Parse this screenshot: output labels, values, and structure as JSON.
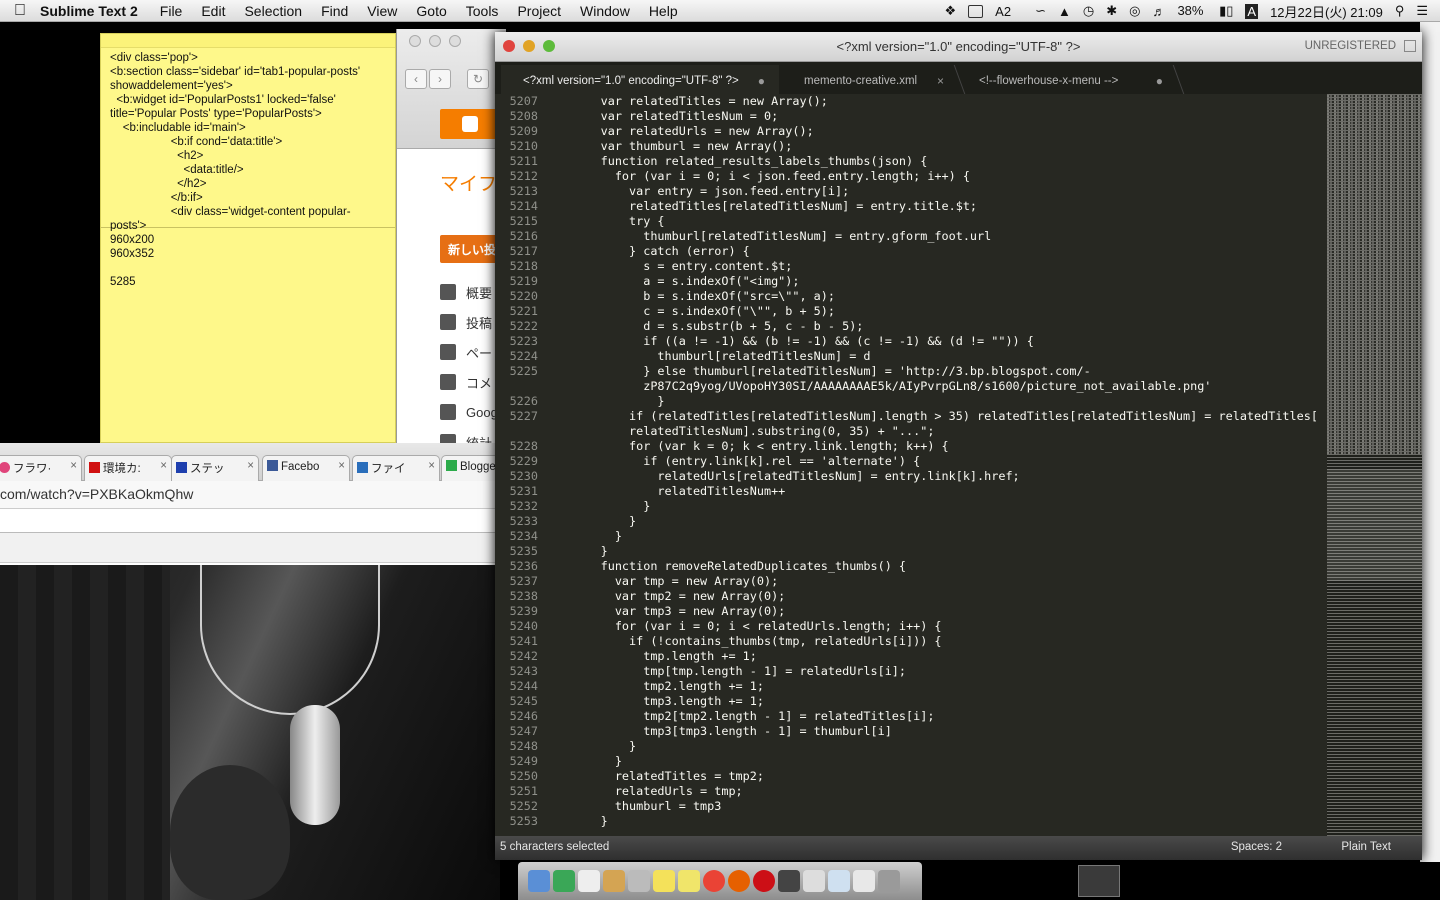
{
  "menubar": {
    "app_name": "Sublime Text 2",
    "menus": [
      "File",
      "Edit",
      "Selection",
      "Find",
      "View",
      "Goto",
      "Tools",
      "Project",
      "Window",
      "Help"
    ],
    "input_indicator": "2",
    "battery": "38%",
    "input_source": "A",
    "date_time": "12月22日(火)  21:09"
  },
  "sticky": {
    "code": "<div class='pop'>\n<b:section class='sidebar' id='tab1-popular-posts' showaddelement='yes'>\n  <b:widget id='PopularPosts1' locked='false' title='Popular Posts' type='PopularPosts'>\n    <b:includable id='main'>\n                   <b:if cond='data:title'>\n                     <h2>\n                       <data:title/>\n                     </h2>\n                   </b:if>\n                   <div class='widget-content popular-posts'>",
    "notes": [
      "960x200",
      "960x352",
      "",
      "5285"
    ]
  },
  "blogger": {
    "title": "マイフ",
    "new_post": "新しい投",
    "nav": [
      "概要",
      "投稿",
      "ペー",
      "コメ",
      "Goog",
      "統計"
    ]
  },
  "browser": {
    "tabs": [
      {
        "label": "フラワ·",
        "color": "#e0457b"
      },
      {
        "label": "環境カ:",
        "color": "#d01010"
      },
      {
        "label": "ステッ",
        "color": "#1e3fae"
      },
      {
        "label": "Facebo",
        "color": "#3b5998"
      },
      {
        "label": "ファイ",
        "color": "#2a6ebb"
      },
      {
        "label": "Blogge",
        "color": "#2cab4a"
      }
    ],
    "url": "com/watch?v=PXBKaOkmQhw"
  },
  "sublime": {
    "title": "<?xml version=\"1.0\" encoding=\"UTF-8\" ?>",
    "unregistered": "UNREGISTERED",
    "tabs": [
      {
        "label": "<?xml version=\"1.0\" encoding=\"UTF-8\" ?>",
        "close": "●"
      },
      {
        "label": "memento-creative.xml",
        "close": "×"
      },
      {
        "label": "<!--flowerhouse-x-menu -->",
        "close": "●"
      }
    ],
    "lines": [
      {
        "n": "5207",
        "t": "      var relatedTitles = new Array();"
      },
      {
        "n": "5208",
        "t": "      var relatedTitlesNum = 0;"
      },
      {
        "n": "5209",
        "t": "      var relatedUrls = new Array();"
      },
      {
        "n": "5210",
        "t": "      var thumburl = new Array();"
      },
      {
        "n": "5211",
        "t": "      function related_results_labels_thumbs(json) {"
      },
      {
        "n": "5212",
        "t": "        for (var i = 0; i < json.feed.entry.length; i++) {"
      },
      {
        "n": "5213",
        "t": "          var entry = json.feed.entry[i];"
      },
      {
        "n": "5214",
        "t": "          relatedTitles[relatedTitlesNum] = entry.title.$t;"
      },
      {
        "n": "5215",
        "t": "          try {"
      },
      {
        "n": "5216",
        "t": "            thumburl[relatedTitlesNum] = entry.gform_foot.url"
      },
      {
        "n": "5217",
        "t": "          } catch (error) {"
      },
      {
        "n": "5218",
        "t": "            s = entry.content.$t;"
      },
      {
        "n": "5219",
        "t": "            a = s.indexOf(\"<img\");"
      },
      {
        "n": "5220",
        "t": "            b = s.indexOf(\"src=\\\"\", a);"
      },
      {
        "n": "5221",
        "t": "            c = s.indexOf(\"\\\"\", b + 5);"
      },
      {
        "n": "5222",
        "t": "            d = s.substr(b + 5, c - b - 5);"
      },
      {
        "n": "5223",
        "t": "            if ((a != -1) && (b != -1) && (c != -1) && (d != \"\")) {"
      },
      {
        "n": "5224",
        "t": "              thumburl[relatedTitlesNum] = d"
      },
      {
        "n": "5225",
        "t": "            } else thumburl[relatedTitlesNum] = 'http://3.bp.blogspot.com/-"
      },
      {
        "n": "",
        "t": "            zP87C2q9yog/UVopoHY30SI/AAAAAAAAE5k/AIyPvrpGLn8/s1600/picture_not_available.png'"
      },
      {
        "n": "5226",
        "t": "              }"
      },
      {
        "n": "5227",
        "t": "          if (relatedTitles[relatedTitlesNum].length > 35) relatedTitles[relatedTitlesNum] = relatedTitles["
      },
      {
        "n": "",
        "t": "          relatedTitlesNum].substring(0, 35) + \"...\";"
      },
      {
        "n": "5228",
        "t": "          for (var k = 0; k < entry.link.length; k++) {"
      },
      {
        "n": "5229",
        "t": "            if (entry.link[k].rel == 'alternate') {"
      },
      {
        "n": "5230",
        "t": "              relatedUrls[relatedTitlesNum] = entry.link[k].href;"
      },
      {
        "n": "5231",
        "t": "              relatedTitlesNum++"
      },
      {
        "n": "5232",
        "t": "            }"
      },
      {
        "n": "5233",
        "t": "          }"
      },
      {
        "n": "5234",
        "t": "        }"
      },
      {
        "n": "5235",
        "t": "      }"
      },
      {
        "n": "5236",
        "t": "      function removeRelatedDuplicates_thumbs() {"
      },
      {
        "n": "5237",
        "t": "        var tmp = new Array(0);"
      },
      {
        "n": "5238",
        "t": "        var tmp2 = new Array(0);"
      },
      {
        "n": "5239",
        "t": "        var tmp3 = new Array(0);"
      },
      {
        "n": "5240",
        "t": "        for (var i = 0; i < relatedUrls.length; i++) {"
      },
      {
        "n": "5241",
        "t": "          if (!contains_thumbs(tmp, relatedUrls[i])) {"
      },
      {
        "n": "5242",
        "t": "            tmp.length += 1;"
      },
      {
        "n": "5243",
        "t": "            tmp[tmp.length - 1] = relatedUrls[i];"
      },
      {
        "n": "5244",
        "t": "            tmp2.length += 1;"
      },
      {
        "n": "5245",
        "t": "            tmp3.length += 1;"
      },
      {
        "n": "5246",
        "t": "            tmp2[tmp2.length - 1] = relatedTitles[i];"
      },
      {
        "n": "5247",
        "t": "            tmp3[tmp3.length - 1] = thumburl[i]"
      },
      {
        "n": "5248",
        "t": "          }"
      },
      {
        "n": "5249",
        "t": "        }"
      },
      {
        "n": "5250",
        "t": "        relatedTitles = tmp2;"
      },
      {
        "n": "5251",
        "t": "        relatedUrls = tmp;"
      },
      {
        "n": "5252",
        "t": "        thumburl = tmp3"
      },
      {
        "n": "5253",
        "t": "      }"
      }
    ],
    "status_left": "5 characters selected",
    "status_spaces": "Spaces: 2",
    "status_syntax": "Plain Text"
  }
}
